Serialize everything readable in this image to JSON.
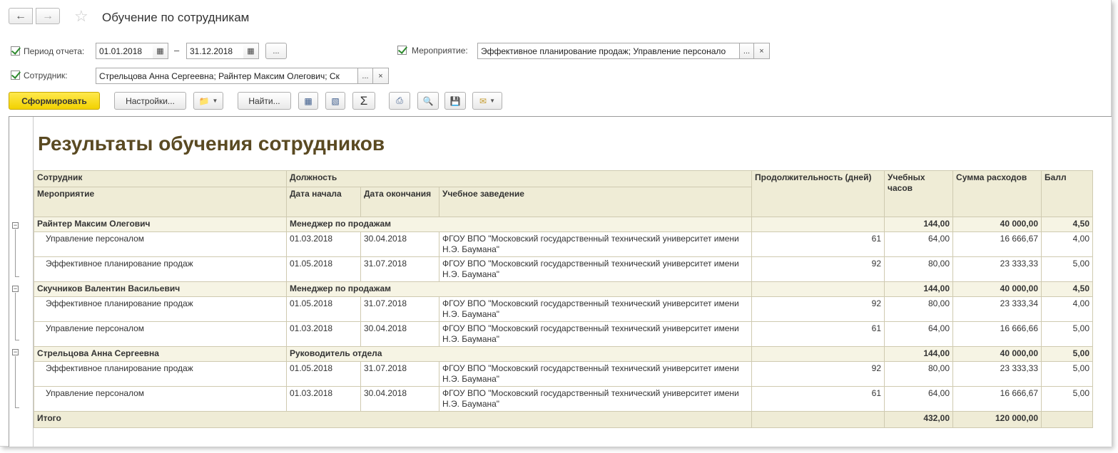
{
  "window": {
    "title": "Обучение по сотрудникам"
  },
  "icons": {
    "back": "arrow-left-icon",
    "forward": "arrow-right-icon",
    "favorite": "star-icon"
  },
  "filters": {
    "period_label": "Период отчета:",
    "date_from": "01.01.2018",
    "date_to": "31.12.2018",
    "dash": "–",
    "more": "...",
    "event_label": "Мероприятие:",
    "event_value": "Эффективное планирование продаж; Управление персонало",
    "employee_label": "Сотрудник:",
    "employee_value": "Стрельцова Анна Сергеевна; Райнтер Максим Олегович; Ск",
    "clear": "×"
  },
  "toolbar": {
    "generate": "Сформировать",
    "settings": "Настройки...",
    "find": "Найти...",
    "sum": "Σ"
  },
  "report": {
    "title": "Результаты обучения сотрудников",
    "headers": {
      "employee": "Сотрудник",
      "position": "Должность",
      "event": "Мероприятие",
      "start": "Дата начала",
      "end": "Дата окончания",
      "institution": "Учебное заведение",
      "duration": "Продолжительность (дней)",
      "hours": "Учебных часов",
      "cost": "Сумма расходов",
      "score": "Балл"
    },
    "groups": [
      {
        "name": "Райнтер Максим Олегович",
        "position": "Менеджер по продажам",
        "hours": "144,00",
        "cost": "40 000,00",
        "score": "4,50",
        "rows": [
          {
            "event": "Управление персоналом",
            "start": "01.03.2018",
            "end": "30.04.2018",
            "institution": "ФГОУ ВПО \"Московский государственный технический университет имени Н.Э. Баумана\"",
            "days": "61",
            "hours": "64,00",
            "cost": "16 666,67",
            "score": "4,00"
          },
          {
            "event": "Эффективное планирование продаж",
            "start": "01.05.2018",
            "end": "31.07.2018",
            "institution": "ФГОУ ВПО \"Московский государственный технический университет имени Н.Э. Баумана\"",
            "days": "92",
            "hours": "80,00",
            "cost": "23 333,33",
            "score": "5,00"
          }
        ]
      },
      {
        "name": "Скучников Валентин Васильевич",
        "position": "Менеджер по продажам",
        "hours": "144,00",
        "cost": "40 000,00",
        "score": "4,50",
        "rows": [
          {
            "event": "Эффективное планирование продаж",
            "start": "01.05.2018",
            "end": "31.07.2018",
            "institution": "ФГОУ ВПО \"Московский государственный технический университет имени Н.Э. Баумана\"",
            "days": "92",
            "hours": "80,00",
            "cost": "23 333,34",
            "score": "4,00"
          },
          {
            "event": "Управление персоналом",
            "start": "01.03.2018",
            "end": "30.04.2018",
            "institution": "ФГОУ ВПО \"Московский государственный технический университет имени Н.Э. Баумана\"",
            "days": "61",
            "hours": "64,00",
            "cost": "16 666,66",
            "score": "5,00"
          }
        ]
      },
      {
        "name": "Стрельцова Анна Сергеевна",
        "position": "Руководитель отдела",
        "hours": "144,00",
        "cost": "40 000,00",
        "score": "5,00",
        "rows": [
          {
            "event": "Эффективное планирование продаж",
            "start": "01.05.2018",
            "end": "31.07.2018",
            "institution": "ФГОУ ВПО \"Московский государственный технический университет имени Н.Э. Баумана\"",
            "days": "92",
            "hours": "80,00",
            "cost": "23 333,33",
            "score": "5,00"
          },
          {
            "event": "Управление персоналом",
            "start": "01.03.2018",
            "end": "30.04.2018",
            "institution": "ФГОУ ВПО \"Московский государственный технический университет имени Н.Э. Баумана\"",
            "days": "61",
            "hours": "64,00",
            "cost": "16 666,67",
            "score": "5,00"
          }
        ]
      }
    ],
    "total": {
      "label": "Итого",
      "hours": "432,00",
      "cost": "120 000,00"
    }
  }
}
